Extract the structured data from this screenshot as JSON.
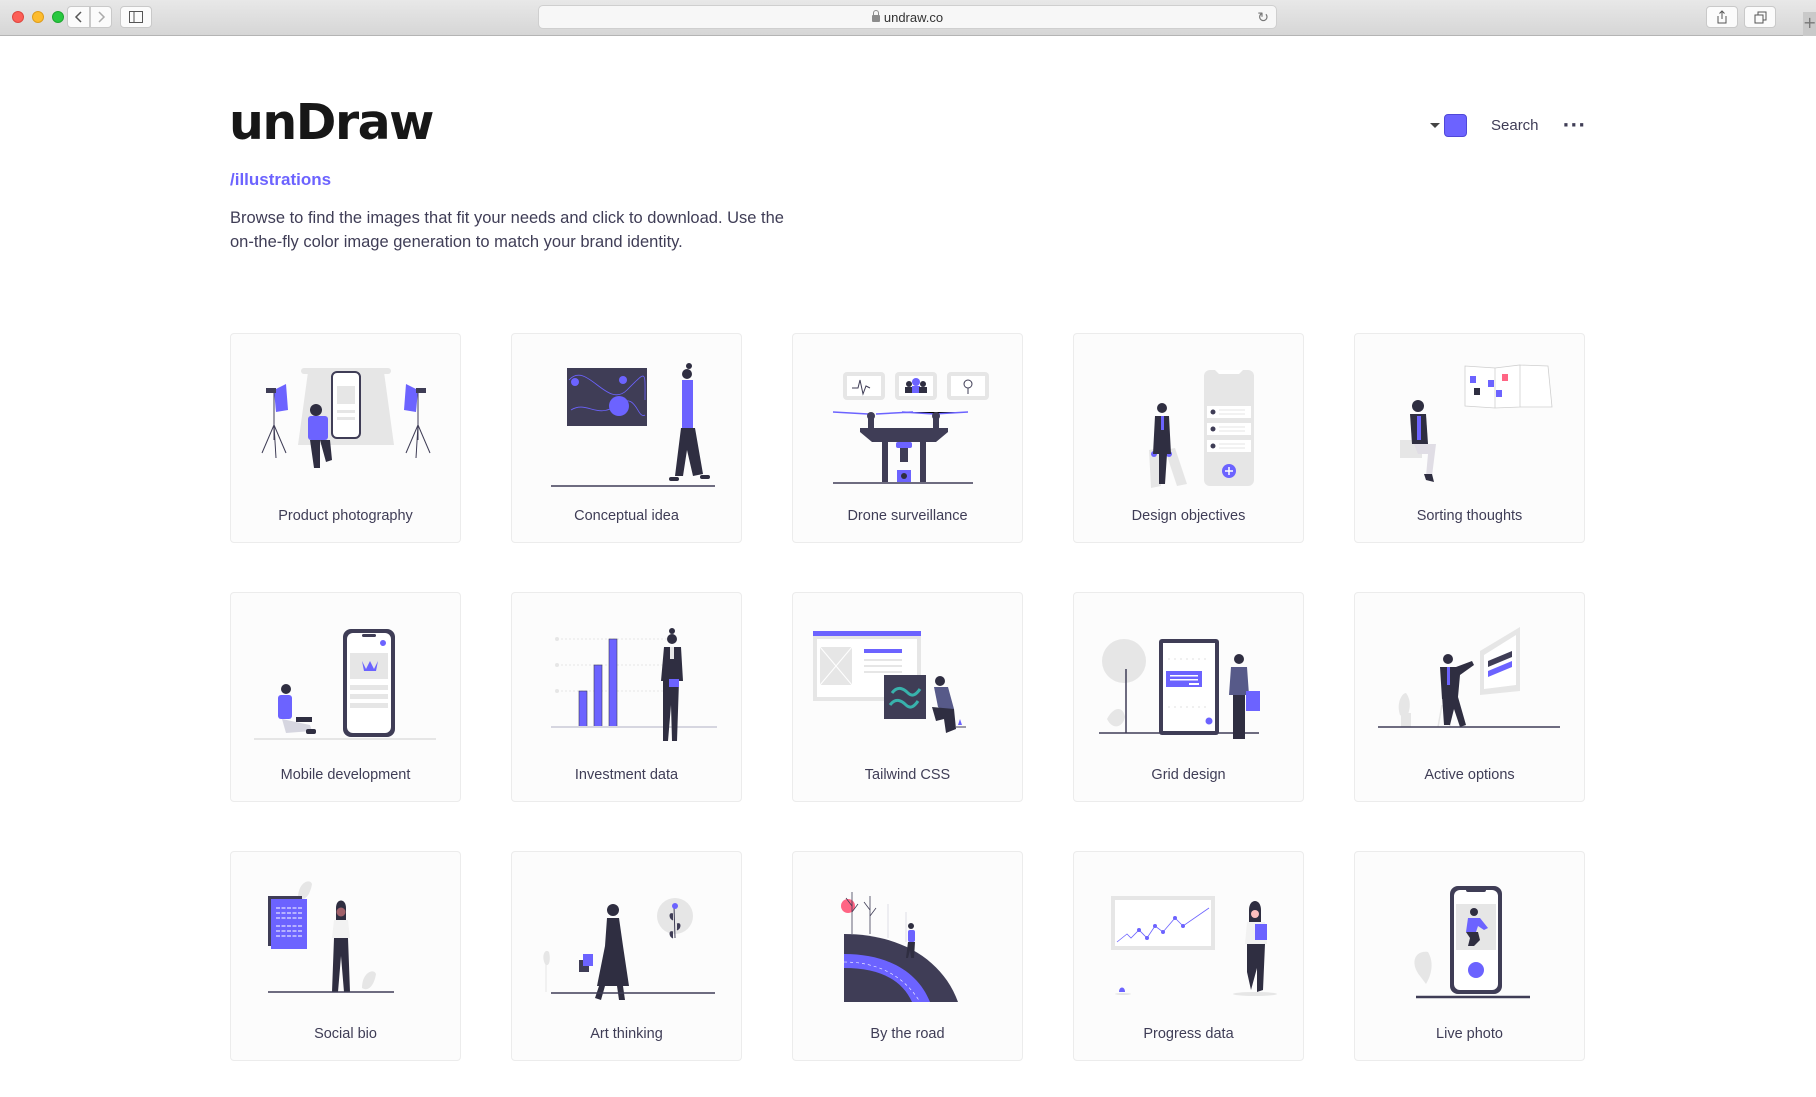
{
  "browser": {
    "url": "undraw.co",
    "icons": [
      "close-dot",
      "minimize-dot",
      "zoom-dot",
      "back-arrow",
      "forward-arrow",
      "sidebar-toggle",
      "lock",
      "reload",
      "share",
      "tabs",
      "new-tab-plus"
    ]
  },
  "header": {
    "brand": "unDraw",
    "subpath": "/illustrations",
    "intro": "Browse to find the images that fit your needs and click to download. Use the on-the-fly color image generation to match your brand identity.",
    "color_picker_value": "#6c63ff",
    "search_label": "Search",
    "more_label": "···"
  },
  "colors": {
    "accent": "#6c63ff",
    "dark": "#3f3d56",
    "ink": "#2f2e41",
    "light_gray": "#e6e6e6",
    "pink": "#ff6584"
  },
  "illustrations": [
    {
      "title": "Product photography"
    },
    {
      "title": "Conceptual idea"
    },
    {
      "title": "Drone surveillance"
    },
    {
      "title": "Design objectives"
    },
    {
      "title": "Sorting thoughts"
    },
    {
      "title": "Mobile development"
    },
    {
      "title": "Investment data"
    },
    {
      "title": "Tailwind CSS"
    },
    {
      "title": "Grid design"
    },
    {
      "title": "Active options"
    },
    {
      "title": "Social bio"
    },
    {
      "title": "Art thinking"
    },
    {
      "title": "By the road"
    },
    {
      "title": "Progress data"
    },
    {
      "title": "Live photo"
    }
  ]
}
